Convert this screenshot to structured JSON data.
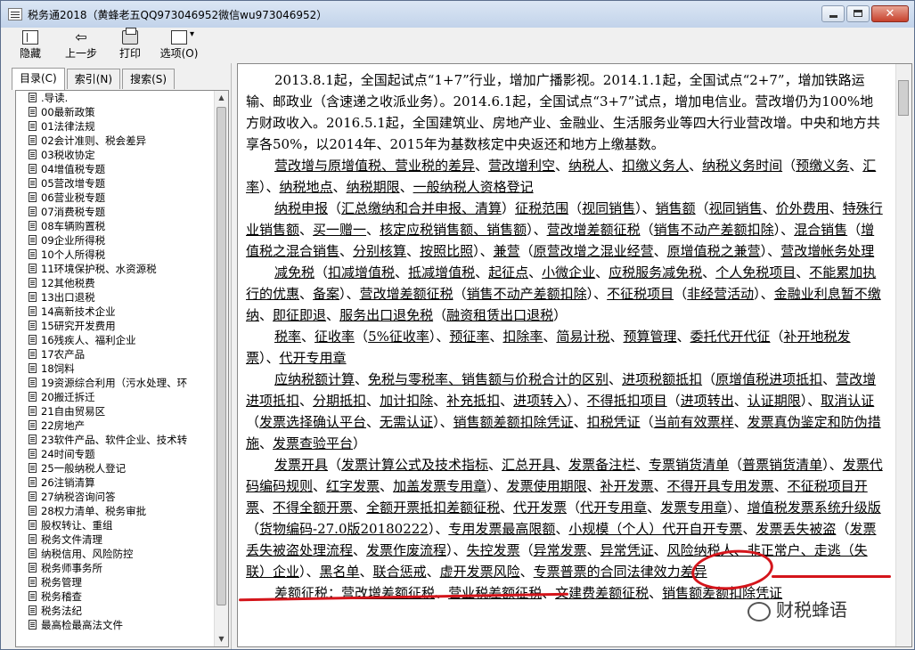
{
  "window": {
    "title": "税务通2018（黄蜂老五QQ973046952微信wu973046952）"
  },
  "toolbar": {
    "hide_label": "隐藏",
    "back_label": "上一步",
    "print_label": "打印",
    "options_label": "选项(O)"
  },
  "nav": {
    "tabs": [
      "目录(C)",
      "索引(N)",
      "搜索(S)"
    ],
    "items": [
      ".导读.",
      "00最新政策",
      "01法律法规",
      "02会计准则、税会差异",
      "03税收协定",
      "04增值税专题",
      "05营改增专题",
      "06营业税专题",
      "07消费税专题",
      "08车辆购置税",
      "09企业所得税",
      "10个人所得税",
      "11环境保护税、水资源税",
      "12其他税费",
      "13出口退税",
      "14高新技术企业",
      "15研究开发费用",
      "16残疾人、福利企业",
      "17农产品",
      "18饲料",
      "19资源综合利用（污水处理、环",
      "20搬迁拆迁",
      "21自由贸易区",
      "22房地产",
      "23软件产品、软件企业、技术转",
      "24时间专题",
      "25一般纳税人登记",
      "26注销清算",
      "27纳税咨询问答",
      "28权力清单、税务审批",
      "股权转让、重组",
      "税务文件清理",
      "纳税信用、风险防控",
      "税务师事务所",
      "税务管理",
      "税务稽查",
      "税务法纪",
      "最高检最高法文件"
    ]
  },
  "content": {
    "intro": "2013.8.1起，全国起试点“1+7”行业，增加广播影视。2014.1.1起，全国试点“2+7”，增加铁路运输、邮政业（含速递之收派业务）。2014.6.1起，全国试点“3+7”试点，增加电信业。营改增仍为100%地方财政收入。2016.5.1起，全国建筑业、房地产业、金融业、生活服务业等四大行业营改增。中央和地方共享各50%，以2014年、2015年为基数核定中央返还和地方上缴基数。",
    "p1": [
      "营改增与原增值税、营业税的差异",
      "、",
      "营改增利空",
      "、",
      "纳税人",
      "、",
      "扣缴义务人",
      "、",
      "纳税义务时间",
      "（",
      "预缴义务",
      "、",
      "汇率",
      "）、",
      "纳税地点",
      "、",
      "纳税期限",
      "、",
      "一般纳税人资格登记"
    ],
    "p2": [
      "纳税申报",
      "（",
      "汇总缴纳和合并申报、清算",
      "）",
      "征税范围",
      "（",
      "视同销售",
      "）、",
      "销售额",
      "（",
      "视同销售",
      "、",
      "价外费用",
      "、",
      "特殊行业销售额",
      "、",
      "买一赠一",
      "、",
      "核定应税销售额、销售额",
      "）、",
      "营改增差额征税",
      "（",
      "销售不动产差额扣除",
      "）、",
      "混合销售",
      "（",
      "增值税之混合销售",
      "、",
      "分别核算",
      "、",
      "按照比照",
      "）、",
      "兼营",
      "（",
      "原营改增之混业经营",
      "、",
      "原增值税之兼营",
      "）、",
      "营改增帐务处理"
    ],
    "p3": [
      "减免税",
      "（",
      "扣减增值税",
      "、",
      "抵减增值税",
      "、",
      "起征点",
      "、",
      "小微企业",
      "、",
      "应税服务减免税",
      "、",
      "个人免税项目",
      "、",
      "不能累加执行的优惠",
      "、",
      "备案",
      "）、",
      "营改增差额征税",
      "（",
      "销售不动产差额扣除",
      "）、",
      "不征税项目",
      "（",
      "非经营活动",
      "）、",
      "金融业利息暂不缴纳",
      "、",
      "即征即退",
      "、",
      "服务出口退免税",
      "（",
      "融资租赁出口退税",
      "）"
    ],
    "p4": [
      "税率",
      "、",
      "征收率",
      "（",
      "5%征收率",
      "）、",
      "预征率",
      "、",
      "扣除率",
      "、",
      "简易计税",
      "、",
      "预算管理",
      "、",
      "委托代开代征",
      "（",
      "补开地税发票",
      "）、",
      "代开专用章"
    ],
    "p5": [
      "应纳税额计算",
      "、",
      "免税与零税率、销售额与价税合计的区别",
      "、",
      "进项税额抵扣",
      "（",
      "原增值税进项抵扣",
      "、",
      "营改增进项抵扣",
      "、",
      "分期抵扣",
      "、",
      "加计扣除",
      "、",
      "补充抵扣",
      "、",
      "进项转入",
      "）、",
      "不得抵扣项目",
      "（",
      "进项转出",
      "、",
      "认证期限",
      "）、",
      "取消认证",
      "（",
      "发票选择确认平台",
      "、",
      "无需认证",
      "）、",
      "销售额差额扣除凭证",
      "、",
      "扣税凭证",
      "（",
      "当前有效票样",
      "、",
      "发票真伪鉴定和防伪措施",
      "、",
      "发票查验平台",
      "）"
    ],
    "p6": [
      "发票开具",
      "（",
      "发票计算公式及技术指标",
      "、",
      "汇总开具",
      "、",
      "发票备注栏",
      "、",
      "专票销货清单",
      "（",
      "普票销货清单",
      "）、",
      "发票代码编码规则",
      "、",
      "红字发票",
      "、",
      "加盖发票专用章",
      "）、",
      "发票使用期限",
      "、",
      "补开发票",
      "、",
      "不得开具专用发票",
      "、",
      "不征税项目开票",
      "、",
      "不得全额开票",
      "、",
      "全额开票抵扣差额征税",
      "、",
      "代开发票",
      "（",
      "代开专用章",
      "、",
      "发票专用章",
      "）、",
      "增值税发票系统升级版",
      "（",
      "货物编码-27.0版20180222",
      "）、",
      "专用发票最高限额",
      "、",
      "小规模（个人）代开自开专票",
      "、",
      "发票丢失被盗",
      "（",
      "发票丢失被盗处理流程",
      "、",
      "发票作废流程",
      "）、",
      "失控发票",
      "（",
      "异常发票",
      "、",
      "异常凭证",
      "、",
      "风险纳税人、非正常户、走逃（失联）企业",
      "）、",
      "黑名单",
      "、",
      "联合惩戒",
      "、",
      "虚开发票风险",
      "、",
      "专票普票的合同法律效力差异"
    ],
    "p7": [
      "差额征税",
      "：",
      "营改增差额征税",
      "、",
      "营业税差额征税",
      "、",
      "文建费差额征税",
      "、",
      "销售额差额扣除凭证"
    ]
  },
  "watermark": {
    "text": "财税蜂语"
  },
  "colors": {
    "annotation": "#d4151b"
  }
}
